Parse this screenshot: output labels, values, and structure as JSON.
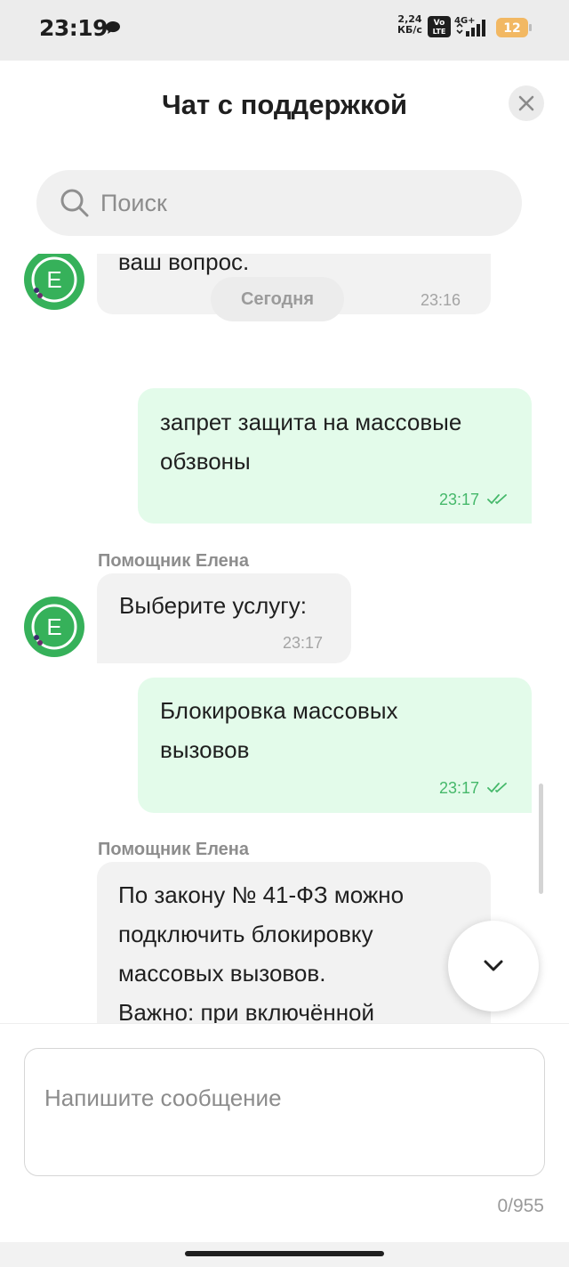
{
  "status_bar": {
    "time": "23:19",
    "speed_value": "2,24",
    "speed_unit": "КБ/с",
    "volte": "VoLTE",
    "network": "4G+",
    "battery": "12"
  },
  "header": {
    "title": "Чат с поддержкой"
  },
  "search": {
    "placeholder": "Поиск"
  },
  "avatar_letter": "E",
  "messages": [
    {
      "direction": "in",
      "text": "ваш вопрос.",
      "time": "23:16"
    },
    {
      "type": "date",
      "label": "Сегодня"
    },
    {
      "direction": "out",
      "text": "запрет защита на массовые\nобзвоны",
      "time": "23:17"
    },
    {
      "direction": "in",
      "sender": "Помощник Елена",
      "text": "Выберите услугу:",
      "time": "23:17"
    },
    {
      "direction": "out",
      "text": "Блокировка массовых\nвызовов",
      "time": "23:17"
    },
    {
      "direction": "in",
      "sender": "Помощник Елена",
      "text": "По закону № 41-ФЗ можно\nподключить блокировку\nмассовых вызовов.\nВажно: при включённой\nблокировке звонки от"
    }
  ],
  "composer": {
    "placeholder": "Напишите сообщение",
    "counter": "0/955"
  },
  "colors": {
    "accent_green": "#21a038",
    "outgoing_bubble": "#e3fbea",
    "incoming_bubble": "#f2f2f2"
  }
}
